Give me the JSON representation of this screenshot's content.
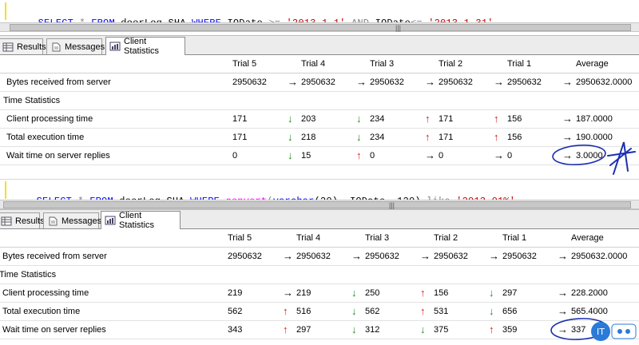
{
  "panel1": {
    "sql": {
      "t1": "SELECT",
      "t2": " * ",
      "t3": "FROM",
      "t4": " doorLog_SHA ",
      "t5": "WHERE",
      "t6": " IODate ",
      "t7": ">=",
      "t8": " ",
      "t9": "'2013-1-1'",
      "t10": " ",
      "t11": "AND",
      "t12": " IODate",
      "t13": "<=",
      "t14": " ",
      "t15": "'2013-1-31'"
    },
    "tabs": [
      "Results",
      "Messages",
      "Client Statistics"
    ],
    "headers": [
      "Trial 5",
      "Trial 4",
      "Trial 3",
      "Trial 2",
      "Trial 1",
      "Average"
    ],
    "rows": [
      {
        "label": "Bytes received from server",
        "values": [
          "2950632",
          "2950632",
          "2950632",
          "2950632",
          "2950632",
          "2950632.0000"
        ],
        "arrows": [
          "right",
          "right",
          "right",
          "right",
          "right"
        ]
      },
      {
        "label": "Time Statistics",
        "section": true
      },
      {
        "label": "Client processing time",
        "values": [
          "171",
          "203",
          "234",
          "171",
          "156",
          "187.0000"
        ],
        "arrows": [
          "down",
          "down",
          "up",
          "up",
          "right"
        ]
      },
      {
        "label": "Total execution time",
        "values": [
          "171",
          "218",
          "234",
          "171",
          "156",
          "190.0000"
        ],
        "arrows": [
          "down",
          "down",
          "up",
          "up",
          "right"
        ]
      },
      {
        "label": "Wait time on server replies",
        "values": [
          "0",
          "15",
          "0",
          "0",
          "0",
          "3.0000"
        ],
        "arrows": [
          "down",
          "up",
          "right",
          "right",
          "right"
        ]
      }
    ]
  },
  "panel2": {
    "sql": {
      "t1": "SELECT",
      "t2": " * ",
      "t3": "FROM",
      "t4": " doorLog_SHA ",
      "t5": "WHERE",
      "t6": " ",
      "t7": "convert",
      "t8": "(",
      "t9": "varchar",
      "t10": "(20), IODate, 120) ",
      "t11": "like",
      "t12": " ",
      "t13": "'2013-01%'"
    },
    "tabs": [
      "Results",
      "Messages",
      "Client Statistics"
    ],
    "headers": [
      "Trial 5",
      "Trial 4",
      "Trial 3",
      "Trial 2",
      "Trial 1",
      "Average"
    ],
    "rows": [
      {
        "label": "Bytes received from server",
        "values": [
          "2950632",
          "2950632",
          "2950632",
          "2950632",
          "2950632",
          "2950632.0000"
        ],
        "arrows": [
          "right",
          "right",
          "right",
          "right",
          "right"
        ]
      },
      {
        "label": "Time Statistics",
        "section": true
      },
      {
        "label": "Client processing time",
        "values": [
          "219",
          "219",
          "250",
          "156",
          "297",
          "228.2000"
        ],
        "arrows": [
          "right",
          "down",
          "up",
          "down",
          "right"
        ]
      },
      {
        "label": "Total execution time",
        "values": [
          "562",
          "516",
          "562",
          "531",
          "656",
          "565.4000"
        ],
        "arrows": [
          "up",
          "down",
          "up",
          "down",
          "right"
        ]
      },
      {
        "label": "Wait time on server replies",
        "values": [
          "343",
          "297",
          "312",
          "375",
          "359",
          "337"
        ],
        "arrows": [
          "up",
          "down",
          "down",
          "up",
          "right"
        ]
      }
    ]
  },
  "colors": {
    "up": "#d81818",
    "down": "#1c8a1c",
    "ink": "#1a2fb0",
    "keyword": "#0000ff",
    "string": "#c00000",
    "function": "#ff00ff"
  },
  "icons": {
    "scroll_grip": "|||",
    "watermark": "ithome-logo"
  }
}
